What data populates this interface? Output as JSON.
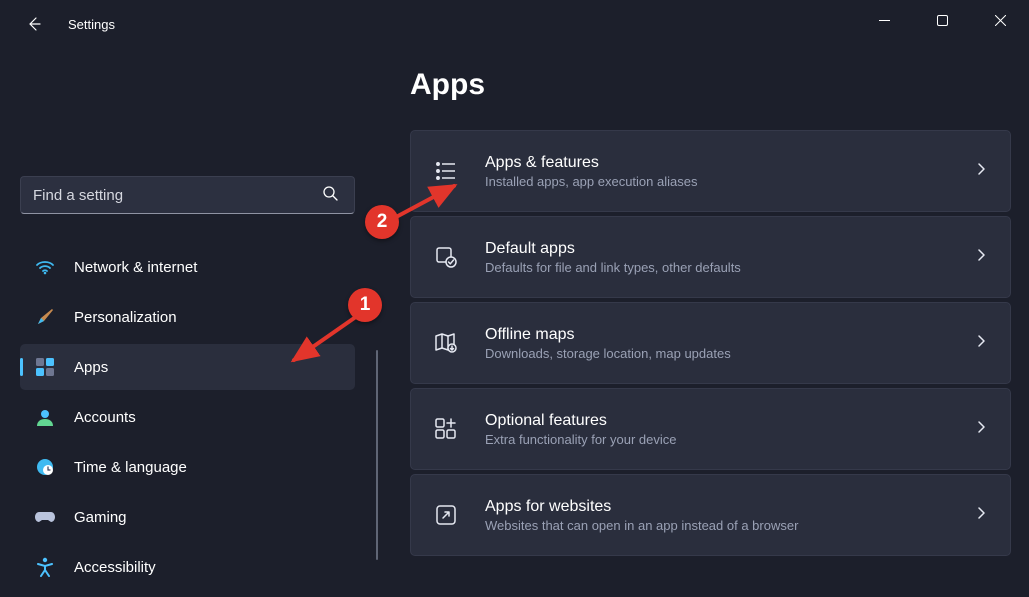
{
  "window": {
    "title": "Settings"
  },
  "search": {
    "placeholder": "Find a setting"
  },
  "nav": {
    "network": {
      "label": "Network & internet"
    },
    "personalization": {
      "label": "Personalization"
    },
    "apps": {
      "label": "Apps"
    },
    "accounts": {
      "label": "Accounts"
    },
    "time": {
      "label": "Time & language"
    },
    "gaming": {
      "label": "Gaming"
    },
    "accessibility": {
      "label": "Accessibility"
    }
  },
  "page": {
    "heading": "Apps",
    "cards": {
      "apps_features": {
        "title": "Apps & features",
        "subtitle": "Installed apps, app execution aliases"
      },
      "default_apps": {
        "title": "Default apps",
        "subtitle": "Defaults for file and link types, other defaults"
      },
      "offline_maps": {
        "title": "Offline maps",
        "subtitle": "Downloads, storage location, map updates"
      },
      "optional": {
        "title": "Optional features",
        "subtitle": "Extra functionality for your device"
      },
      "websites": {
        "title": "Apps for websites",
        "subtitle": "Websites that can open in an app instead of a browser"
      }
    }
  },
  "annotations": {
    "step1": "1",
    "step2": "2"
  }
}
